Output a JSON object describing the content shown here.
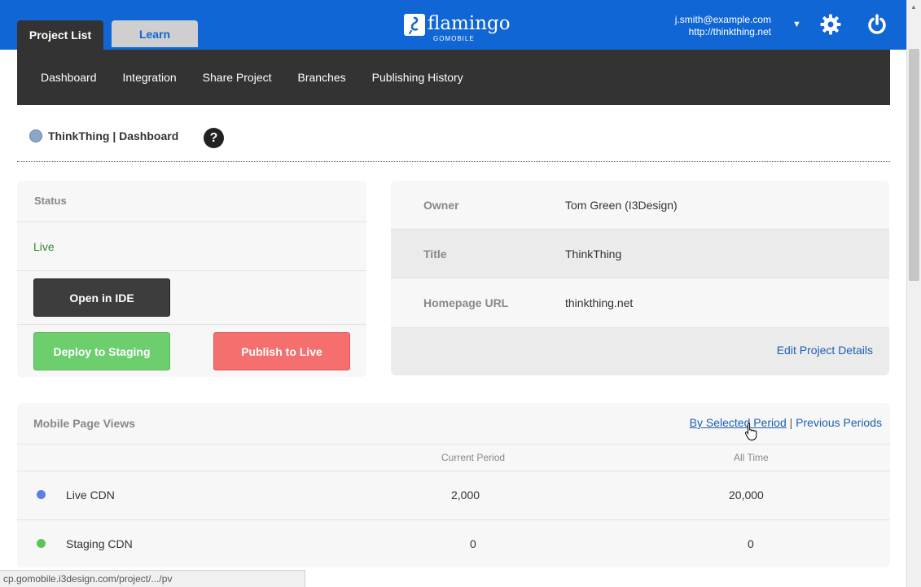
{
  "header": {
    "tabs": [
      {
        "label": "Project List",
        "active": true
      },
      {
        "label": "Learn",
        "active": false
      }
    ],
    "logo": {
      "name": "flamingo",
      "sub": "GOMOBILE"
    },
    "user": {
      "email": "j.smith@example.com",
      "site": "http://thinkthing.net"
    },
    "colors": {
      "brand": "#1066d4",
      "dark": "#333333"
    }
  },
  "subnav": [
    "Dashboard",
    "Integration",
    "Share Project",
    "Branches",
    "Publishing History"
  ],
  "breadcrumb": "ThinkThing | Dashboard",
  "help_label": "?",
  "status_panel": {
    "heading": "Status",
    "status": "Live",
    "buttons": {
      "open_ide": "Open in IDE",
      "deploy": "Deploy to Staging",
      "publish": "Publish to Live"
    }
  },
  "project_info": {
    "rows": [
      {
        "key": "Owner",
        "value": "Tom Green (I3Design)"
      },
      {
        "key": "Title",
        "value": "ThinkThing"
      },
      {
        "key": "Homepage URL",
        "value": "thinkthing.net"
      }
    ],
    "edit_link": "Edit Project Details"
  },
  "page_views": {
    "title": "Mobile Page Views",
    "link_selected": "By Selected Period",
    "separator": "|",
    "link_previous": "Previous Periods",
    "columns": [
      "Current Period",
      "All Time"
    ],
    "rows": [
      {
        "label": "Live CDN",
        "color": "#5b7fe8",
        "current": "2,000",
        "all_time": "20,000"
      },
      {
        "label": "Staging CDN",
        "color": "#5cc45c",
        "current": "0",
        "all_time": "0"
      }
    ]
  },
  "status_bar": "cp.gomobile.i3design.com/project/.../pv"
}
